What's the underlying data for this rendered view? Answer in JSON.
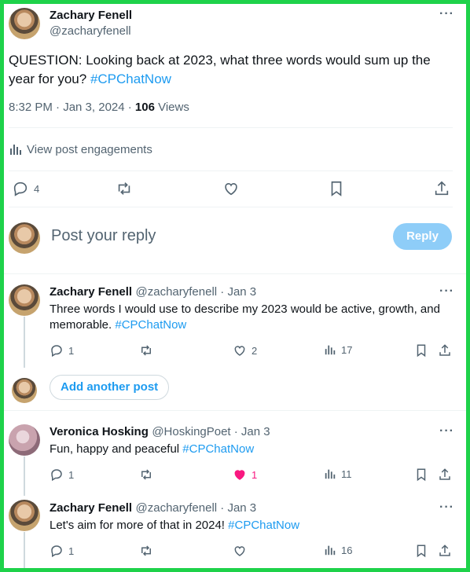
{
  "main_post": {
    "author_name": "Zachary Fenell",
    "author_handle": "@zacharyfenell",
    "text_line1": "QUESTION: Looking back at 2023, what three words would sum up the",
    "text_line2": "year for you? ",
    "hashtag": "#CPChatNow",
    "time": "8:32 PM · Jan 3, 2024 · ",
    "views_count": "106",
    "views_label": " Views",
    "engagements_label": "View post engagements",
    "reply_count": "4"
  },
  "composer": {
    "placeholder": "Post your reply",
    "reply_button": "Reply"
  },
  "replies": [
    {
      "author_name": "Zachary Fenell",
      "meta": "@zacharyfenell · Jan 3",
      "text_line1": "Three words I would use to describe my 2023 would be active, growth, and",
      "text_line2": "memorable. ",
      "hashtag": "#CPChatNow",
      "reply_count": "1",
      "like_count": "2",
      "views_count": "17"
    },
    {
      "author_name": "Veronica Hosking",
      "meta": "@HoskingPoet · Jan 3",
      "text_line1": "Fun, happy and peaceful ",
      "hashtag": "#CPChatNow",
      "reply_count": "1",
      "like_count": "1",
      "views_count": "11"
    },
    {
      "author_name": "Zachary Fenell",
      "meta": "@zacharyfenell · Jan 3",
      "text_line1": "Let's aim for more of that in 2024! ",
      "hashtag": "#CPChatNow",
      "reply_count": "1",
      "views_count": "16"
    }
  ],
  "add_another_post": "Add another post",
  "colors": {
    "accent": "#1d9bf0",
    "like": "#f91880",
    "frame": "#1ed24a"
  }
}
